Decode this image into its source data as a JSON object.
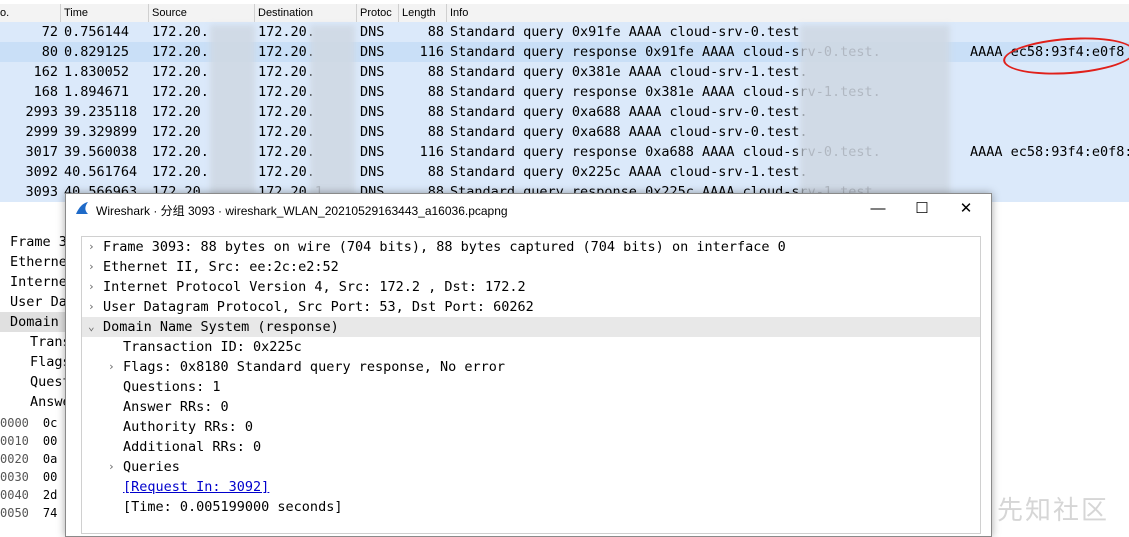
{
  "packet_list": {
    "columns": {
      "no": "o.",
      "time": "Time",
      "source": "Source",
      "destination": "Destination",
      "protocol": "Protoc",
      "length": "Length",
      "info": "Info"
    },
    "rows": [
      {
        "no": "72",
        "time": "0.756144",
        "src": "172.20.",
        "dst": "172.20.",
        "proto": "DNS",
        "len": "88",
        "info": "Standard query 0x91fe AAAA cloud-srv-0.test",
        "extra": ""
      },
      {
        "no": "80",
        "time": "0.829125",
        "src": "172.20.",
        "dst": "172.20.",
        "proto": "DNS",
        "len": "116",
        "info": "Standard query response 0x91fe AAAA cloud-srv-0.test.",
        "extra": "AAAA ec58:93f4:e0f8"
      },
      {
        "no": "162",
        "time": "1.830052",
        "src": "172.20.",
        "dst": "172.20.",
        "proto": "DNS",
        "len": "88",
        "info": "Standard query 0x381e AAAA cloud-srv-1.test.",
        "extra": ""
      },
      {
        "no": "168",
        "time": "1.894671",
        "src": "172.20.",
        "dst": "172.20.",
        "proto": "DNS",
        "len": "88",
        "info": "Standard query response 0x381e AAAA cloud-srv-1.test.",
        "extra": ""
      },
      {
        "no": "2993",
        "time": "39.235118",
        "src": "172.20",
        "dst": "172.20.",
        "proto": "DNS",
        "len": "88",
        "info": "Standard query 0xa688 AAAA cloud-srv-0.test.",
        "extra": ""
      },
      {
        "no": "2999",
        "time": "39.329899",
        "src": "172.20",
        "dst": "172.20.",
        "proto": "DNS",
        "len": "88",
        "info": "Standard query 0xa688 AAAA cloud-srv-0.test.",
        "extra": ""
      },
      {
        "no": "3017",
        "time": "39.560038",
        "src": "172.20.",
        "dst": "172.20.",
        "proto": "DNS",
        "len": "116",
        "info": "Standard query response 0xa688 AAAA cloud-srv-0.test.",
        "extra": "AAAA ec58:93f4:e0f8:"
      },
      {
        "no": "3092",
        "time": "40.561764",
        "src": "172.20.",
        "dst": "172.20.",
        "proto": "DNS",
        "len": "88",
        "info": "Standard query 0x225c AAAA cloud-srv-1.test.",
        "extra": ""
      },
      {
        "no": "3093",
        "time": "40.566963",
        "src": "172.20.",
        "dst": "172.20.1",
        "proto": "DNS",
        "len": "88",
        "info": "Standard query response 0x225c AAAA cloud-srv-1.test.",
        "extra": ""
      }
    ]
  },
  "background_details": [
    "Frame 3",
    "Etherne",
    "Interne",
    "User Da",
    "Domain",
    "Trans",
    "Flags",
    "Quest",
    "Answe"
  ],
  "hex_offsets": [
    {
      "off": "0000",
      "b": "0c"
    },
    {
      "off": "0010",
      "b": "00"
    },
    {
      "off": "0020",
      "b": "0a"
    },
    {
      "off": "0030",
      "b": "00"
    },
    {
      "off": "0040",
      "b": "2d"
    },
    {
      "off": "0050",
      "b": "74"
    }
  ],
  "dialog": {
    "title": "Wireshark · 分组 3093 · wireshark_WLAN_20210529163443_a16036.pcapng",
    "minimize": "—",
    "maximize": "☐",
    "close": "✕",
    "tree": [
      {
        "level": 0,
        "arrow": "›",
        "text": "Frame 3093: 88 bytes on wire (704 bits), 88 bytes captured (704 bits) on interface 0"
      },
      {
        "level": 0,
        "arrow": "›",
        "text": "Ethernet II, Src: ee:2c:e2:52"
      },
      {
        "level": 0,
        "arrow": "›",
        "text": "Internet Protocol Version 4, Src: 172.2    , Dst: 172.2"
      },
      {
        "level": 0,
        "arrow": "›",
        "text": "User Datagram Protocol, Src Port: 53, Dst Port: 60262"
      },
      {
        "level": 0,
        "arrow": "⌄",
        "text": "Domain Name System (response)",
        "hl": true
      },
      {
        "level": 1,
        "arrow": "",
        "text": "Transaction ID: 0x225c"
      },
      {
        "level": 1,
        "arrow": "›",
        "text": "Flags: 0x8180 Standard query response, No error"
      },
      {
        "level": 1,
        "arrow": "",
        "text": "Questions: 1"
      },
      {
        "level": 1,
        "arrow": "",
        "text": "Answer RRs: 0"
      },
      {
        "level": 1,
        "arrow": "",
        "text": "Authority RRs: 0"
      },
      {
        "level": 1,
        "arrow": "",
        "text": "Additional RRs: 0"
      },
      {
        "level": 1,
        "arrow": "›",
        "text": "Queries"
      },
      {
        "level": 1,
        "arrow": "",
        "text": "[Request In: 3092]",
        "link": true
      },
      {
        "level": 1,
        "arrow": "",
        "text": "[Time: 0.005199000 seconds]"
      }
    ]
  },
  "watermark": "先知社区",
  "colors": {
    "row_bg": "#dbe9fa",
    "annotation": "#e0201a",
    "link": "#0000cc"
  }
}
